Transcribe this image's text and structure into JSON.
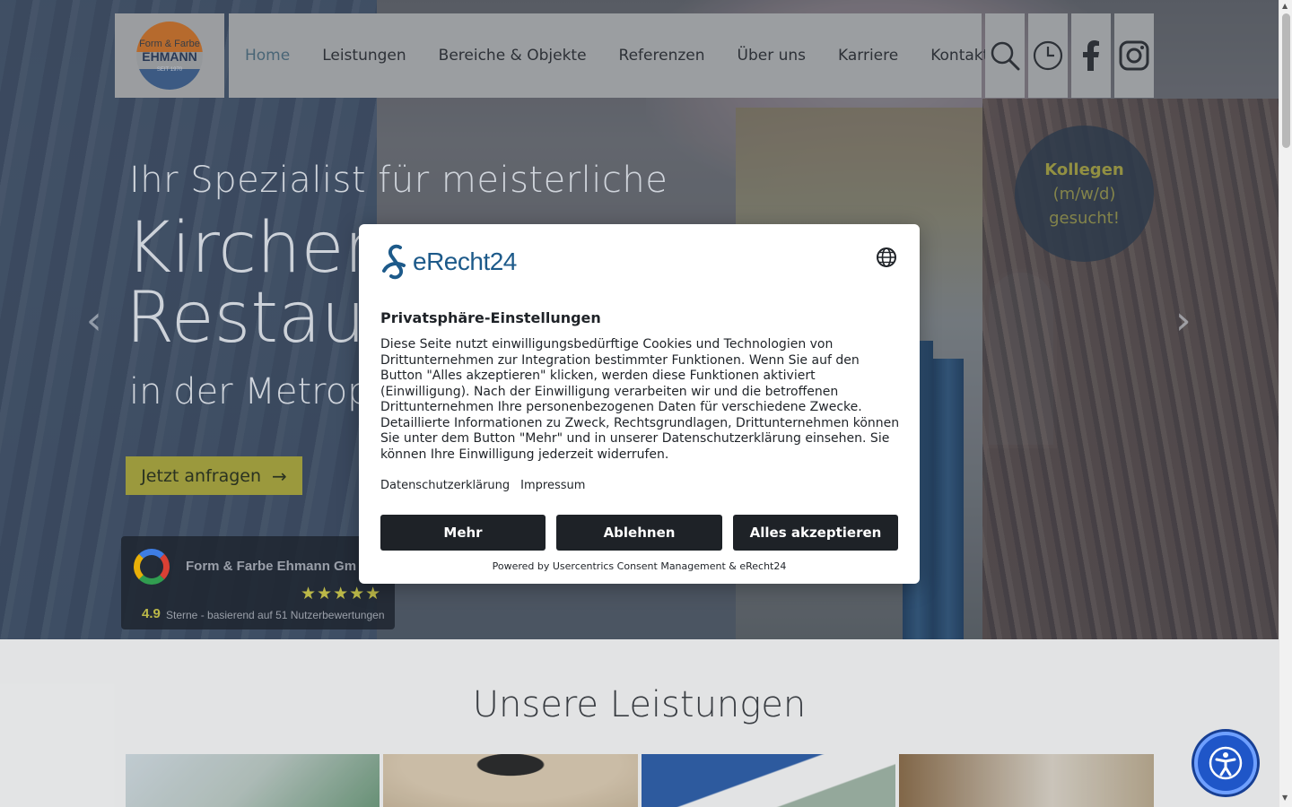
{
  "header": {
    "logo": {
      "line1": "Form & Farbe",
      "line2": "EHMANN",
      "line3": "SEIT 1970"
    },
    "nav": [
      {
        "label": "Home",
        "active": true
      },
      {
        "label": "Leistungen"
      },
      {
        "label": "Bereiche & Objekte"
      },
      {
        "label": "Referenzen"
      },
      {
        "label": "Über uns"
      },
      {
        "label": "Karriere"
      },
      {
        "label": "Kontakt"
      }
    ],
    "icons": [
      "search-icon",
      "clock-icon",
      "facebook-icon",
      "instagram-icon"
    ]
  },
  "hero": {
    "subtitle": "Ihr Spezialist für meisterliche",
    "title_line1": "Kirchen",
    "title_line2": "Restaur",
    "tail": "in der Metropo",
    "cta_label": "Jetzt anfragen",
    "cta_arrow": "→",
    "arrow_left": "‹",
    "arrow_right": "›"
  },
  "review": {
    "company": "Form & Farbe Ehmann Gm",
    "stars": "★★★★★",
    "rating": "4.9",
    "rating_text": "Sterne - basierend auf 51 Nutzerbewertungen"
  },
  "job_badge": {
    "line1": "Kollegen",
    "line2": "(m/w/d)",
    "line3": "gesucht!"
  },
  "section": {
    "title": "Unsere Leistungen"
  },
  "cookie_modal": {
    "brand": "eRecht24",
    "heading": "Privatsphäre-Einstellungen",
    "description": "Diese Seite nutzt einwilligungsbedürftige Cookies und Technologien von Drittunternehmen zur Integration bestimmter Funktionen. Wenn Sie auf den Button \"Alles akzeptieren\" klicken, werden diese Funktionen aktiviert (Einwilligung). Nach der Einwilligung verarbeiten wir und die betroffenen Drittunternehmen Ihre personenbezogenen Daten für verschiedene Zwecke. Detaillierte Informationen zu Zweck, Rechtsgrundlagen, Drittunternehmen können Sie unter dem Button \"Mehr\" und in unserer Datenschutzerklärung einsehen. Sie können Ihre Einwilligung jederzeit widerrufen.",
    "link_privacy": "Datenschutzerklärung",
    "link_imprint": "Impressum",
    "btn_more": "Mehr",
    "btn_decline": "Ablehnen",
    "btn_accept": "Alles akzeptieren",
    "powered_by": "Powered by Usercentrics Consent Management & eRecht24"
  },
  "colors": {
    "accent_olive": "#a6a33e",
    "modal_button": "#1e2227",
    "brand_blue": "#1d5a8a",
    "a11y_blue": "#1f56c8"
  }
}
